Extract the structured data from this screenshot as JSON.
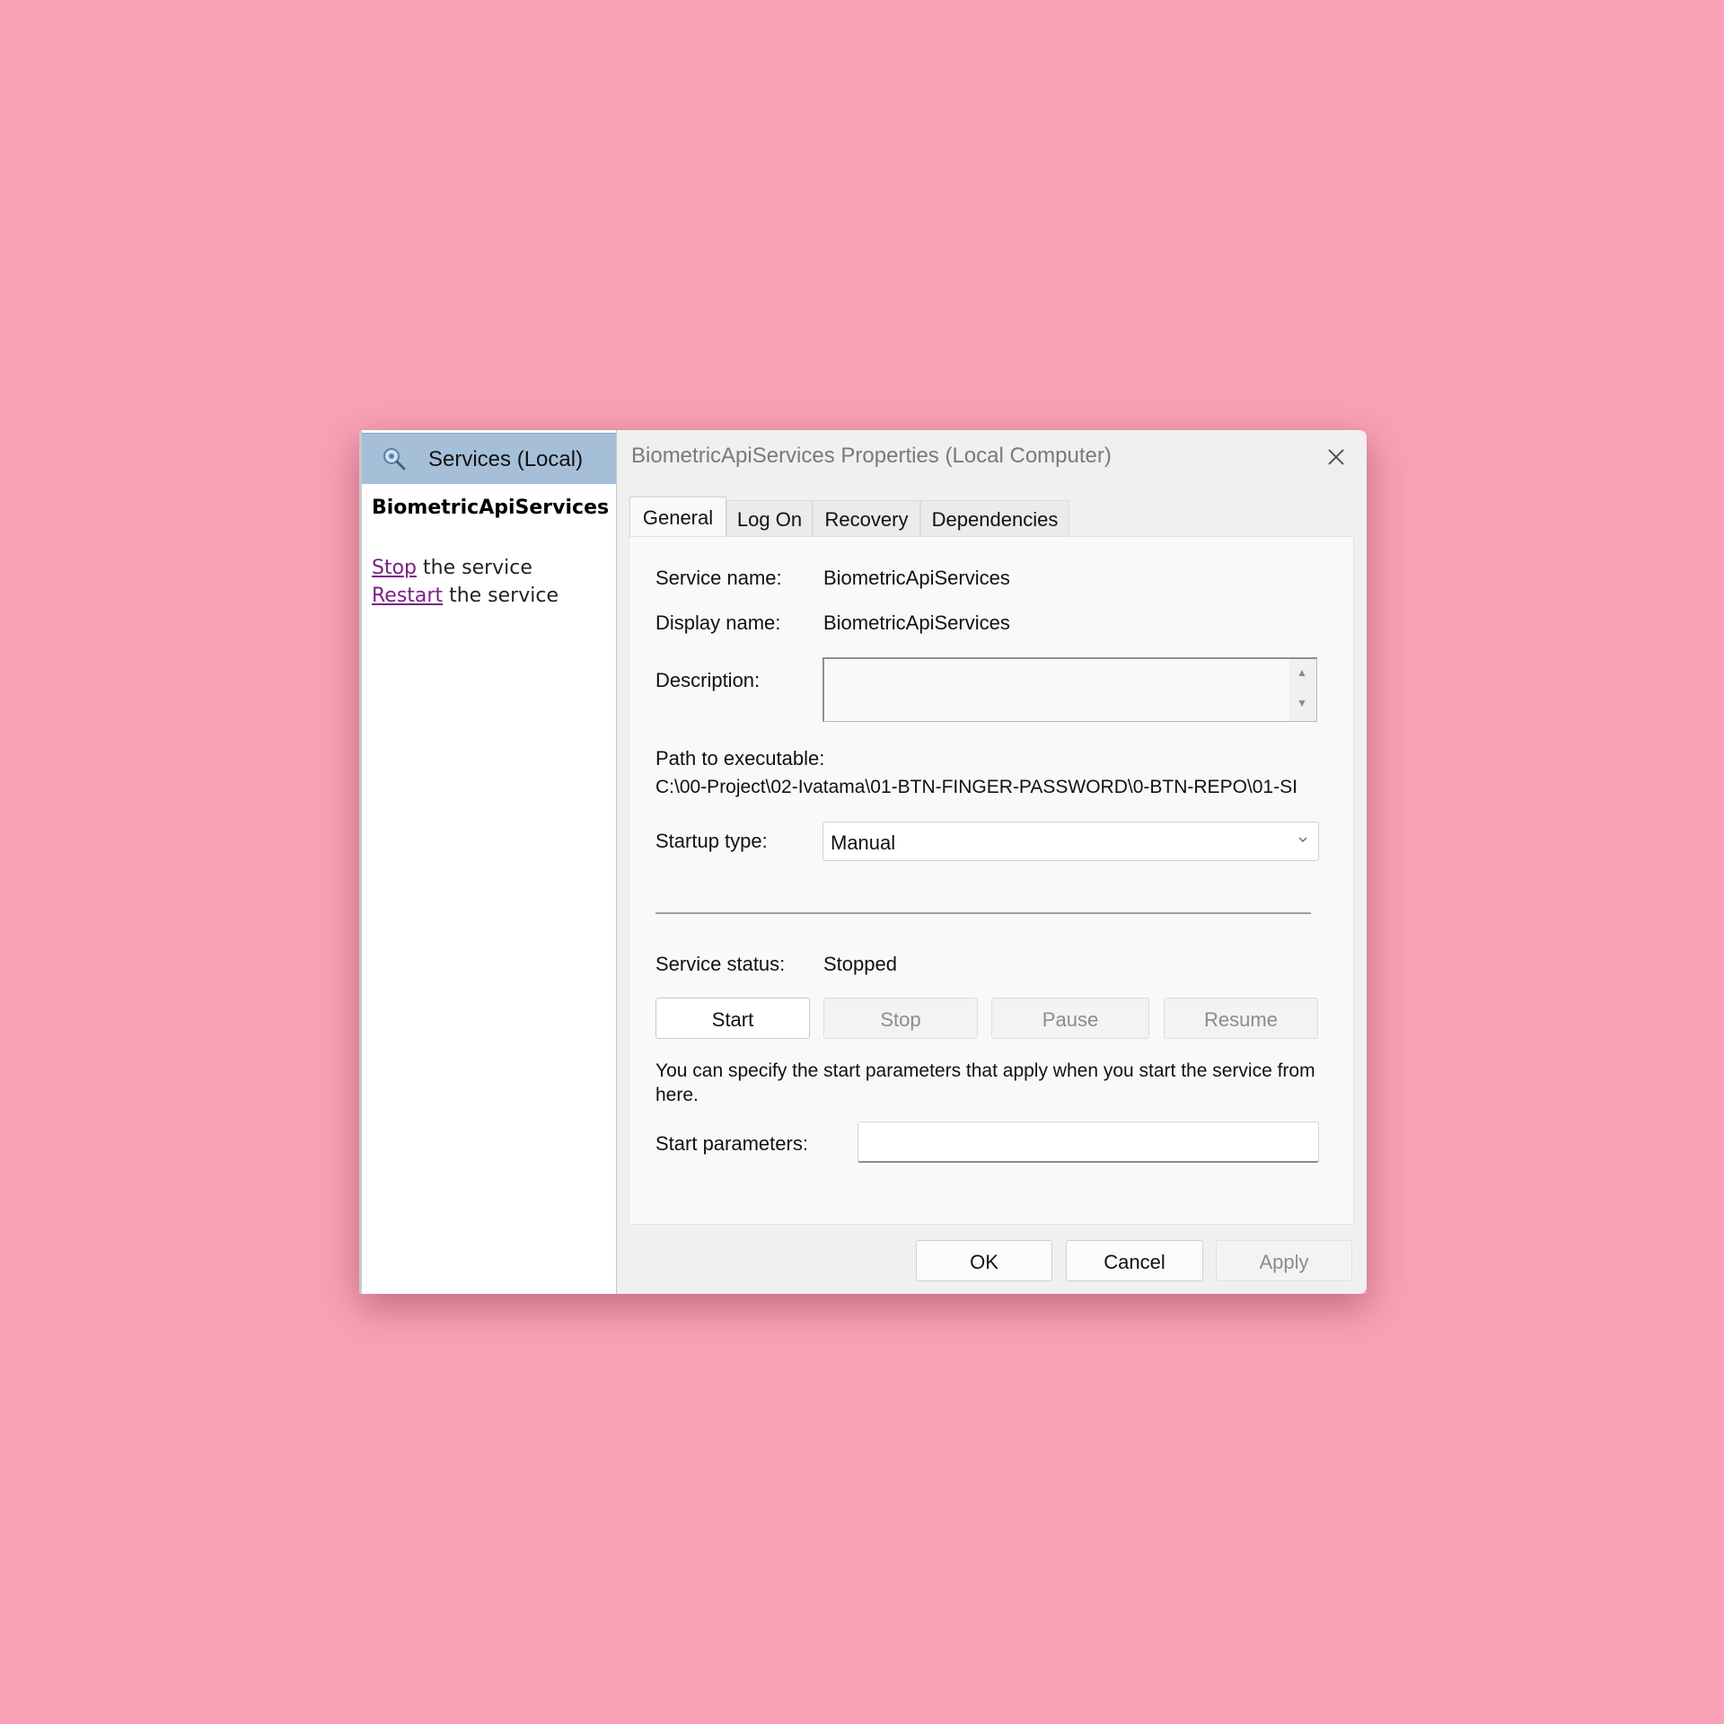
{
  "services_pane": {
    "header_title": "Services (Local)",
    "header_icon": "services-gear-magnifier-icon",
    "service_name": "BiometricApiServices",
    "stop_link": "Stop",
    "stop_suffix": " the service",
    "restart_link": "Restart",
    "restart_suffix": " the service"
  },
  "dialog": {
    "title": "BiometricApiServices Properties (Local Computer)",
    "close_icon": "close-icon",
    "tabs": [
      {
        "label": "General",
        "selected": true
      },
      {
        "label": "Log On",
        "selected": false
      },
      {
        "label": "Recovery",
        "selected": false
      },
      {
        "label": "Dependencies",
        "selected": false
      }
    ],
    "general": {
      "service_name_label": "Service name:",
      "service_name_value": "BiometricApiServices",
      "display_name_label": "Display name:",
      "display_name_value": "BiometricApiServices",
      "description_label": "Description:",
      "description_value": "",
      "path_label": "Path to executable:",
      "path_value": "C:\\00-Project\\02-Ivatama\\01-BTN-FINGER-PASSWORD\\0-BTN-REPO\\01-SI",
      "startup_label": "Startup type:",
      "startup_value": "Manual",
      "status_label": "Service status:",
      "status_value": "Stopped",
      "buttons": {
        "start": "Start",
        "stop": "Stop",
        "pause": "Pause",
        "resume": "Resume"
      },
      "info_text": "You can specify the start parameters that apply when you start the service from here.",
      "start_params_label": "Start parameters:",
      "start_params_value": ""
    },
    "footer": {
      "ok": "OK",
      "cancel": "Cancel",
      "apply": "Apply"
    }
  },
  "colors": {
    "background": "#f9a1b5",
    "pane_header": "#a6bfd9",
    "link": "#7a1f86",
    "disabled_text": "#8c8c8c"
  }
}
